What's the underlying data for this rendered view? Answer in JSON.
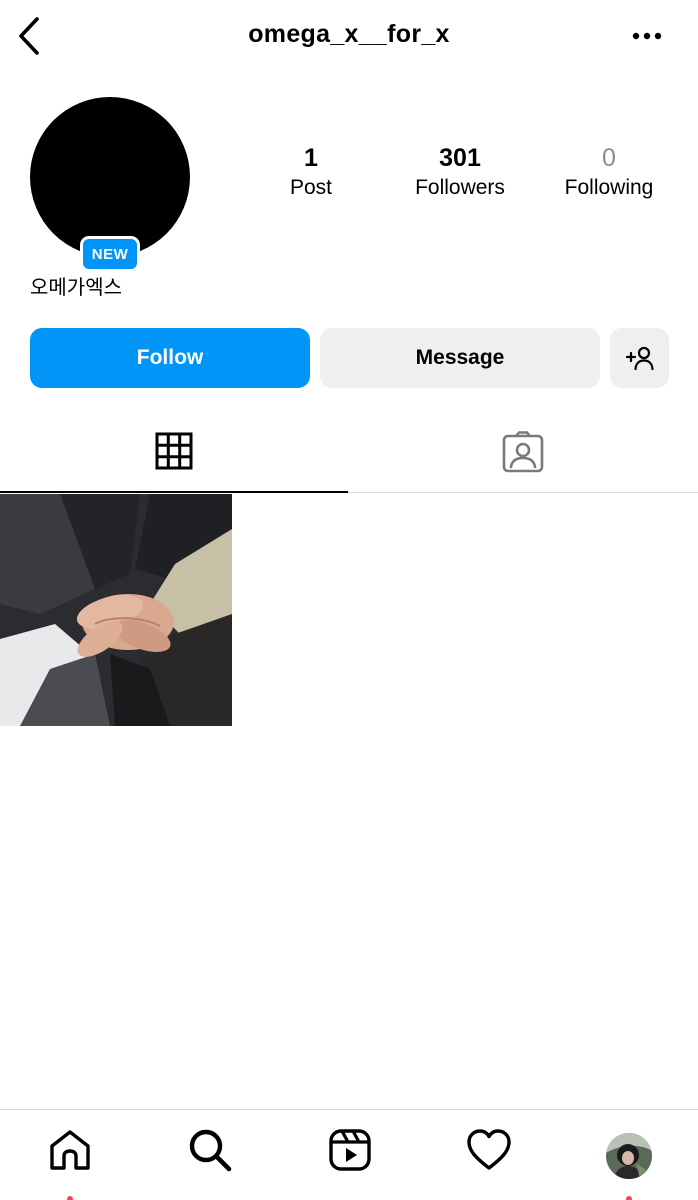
{
  "header": {
    "username": "omega_x__for_x"
  },
  "profile": {
    "display_name": "오메가엑스",
    "badge": "NEW",
    "stats": [
      {
        "value": "1",
        "label": "Post"
      },
      {
        "value": "301",
        "label": "Followers"
      },
      {
        "value": "0",
        "label": "Following"
      }
    ]
  },
  "actions": {
    "follow_label": "Follow",
    "message_label": "Message"
  },
  "tabs": [
    {
      "icon": "grid-icon",
      "active": true
    },
    {
      "icon": "tagged-icon",
      "active": false
    }
  ],
  "posts": [
    {
      "icon": "group-hands-photo"
    }
  ],
  "bottom_nav": [
    {
      "icon": "home-icon",
      "notification_dot": true
    },
    {
      "icon": "search-icon",
      "notification_dot": false
    },
    {
      "icon": "reels-icon",
      "notification_dot": false
    },
    {
      "icon": "heart-icon",
      "notification_dot": false
    },
    {
      "icon": "profile-avatar",
      "notification_dot": true
    }
  ],
  "colors": {
    "accent": "#0095f6",
    "secondary_button": "#efefef",
    "muted_text": "#8e8e8e",
    "notification": "#ed4956"
  }
}
